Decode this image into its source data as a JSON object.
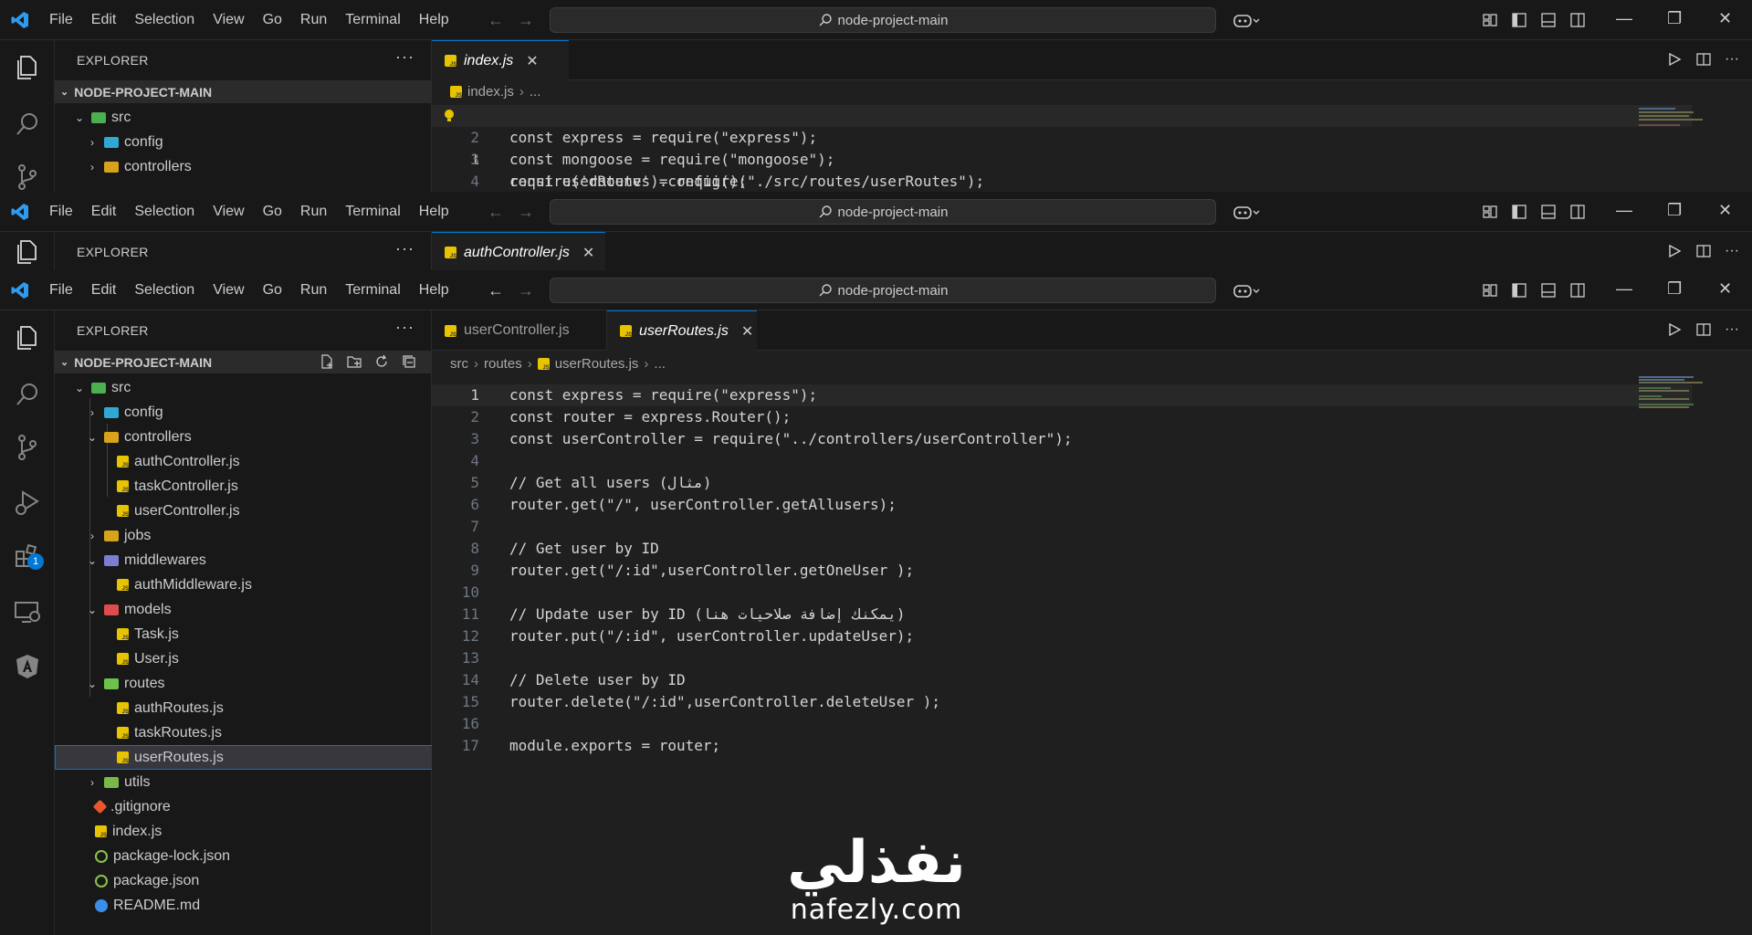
{
  "app": {
    "menu": [
      "File",
      "Edit",
      "Selection",
      "View",
      "Go",
      "Run",
      "Terminal",
      "Help"
    ],
    "search_text": "node-project-main",
    "accent": "#0078d4"
  },
  "window1": {
    "sidebar_title": "EXPLORER",
    "section": "NODE-PROJECT-MAIN",
    "tree": [
      {
        "label": "src",
        "icon": "folder-src-icon"
      },
      {
        "label": "config",
        "icon": "folder-config-icon"
      },
      {
        "label": "controllers",
        "icon": "folder-controllers-icon"
      }
    ],
    "tab": "index.js",
    "breadcrumb": [
      "index.js",
      "..."
    ],
    "lines": [
      {
        "n": "1",
        "t": "require('dotenv').config();"
      },
      {
        "n": "2",
        "t": "const express = require(\"express\");"
      },
      {
        "n": "3",
        "t": "const mongoose = require(\"mongoose\");"
      },
      {
        "n": "4",
        "t": "const userRoutes = require(\"./src/routes/userRoutes\");"
      }
    ]
  },
  "window2": {
    "sidebar_title": "EXPLORER",
    "tab": "authController.js"
  },
  "window3": {
    "sidebar_title": "EXPLORER",
    "section": "NODE-PROJECT-MAIN",
    "tree": [
      {
        "label": "src"
      },
      {
        "label": "config"
      },
      {
        "label": "controllers"
      },
      {
        "label": "authController.js"
      },
      {
        "label": "taskController.js"
      },
      {
        "label": "userController.js"
      },
      {
        "label": "jobs"
      },
      {
        "label": "middlewares"
      },
      {
        "label": "authMiddleware.js"
      },
      {
        "label": "models"
      },
      {
        "label": "Task.js"
      },
      {
        "label": "User.js"
      },
      {
        "label": "routes"
      },
      {
        "label": "authRoutes.js"
      },
      {
        "label": "taskRoutes.js"
      },
      {
        "label": "userRoutes.js"
      },
      {
        "label": "utils"
      },
      {
        "label": ".gitignore"
      },
      {
        "label": "index.js"
      },
      {
        "label": "package-lock.json"
      },
      {
        "label": "package.json"
      },
      {
        "label": "README.md"
      }
    ],
    "tabs": [
      "userController.js",
      "userRoutes.js"
    ],
    "breadcrumb": [
      "src",
      "routes",
      "userRoutes.js",
      "..."
    ],
    "extensions_badge": "1",
    "lines": [
      {
        "n": "1",
        "t": "const express = require(\"express\");"
      },
      {
        "n": "2",
        "t": "const router = express.Router();"
      },
      {
        "n": "3",
        "t": "const userController = require(\"../controllers/userController\");"
      },
      {
        "n": "4",
        "t": ""
      },
      {
        "n": "5",
        "t": "// Get all users (مثال)"
      },
      {
        "n": "6",
        "t": "router.get(\"/\", userController.getAllusers);"
      },
      {
        "n": "7",
        "t": ""
      },
      {
        "n": "8",
        "t": "// Get user by ID"
      },
      {
        "n": "9",
        "t": "router.get(\"/:id\",userController.getOneUser );"
      },
      {
        "n": "10",
        "t": ""
      },
      {
        "n": "11",
        "t": "// Update user by ID (يمكنك إضافة صلاحيات هنا)"
      },
      {
        "n": "12",
        "t": "router.put(\"/:id\", userController.updateUser);"
      },
      {
        "n": "13",
        "t": ""
      },
      {
        "n": "14",
        "t": "// Delete user by ID"
      },
      {
        "n": "15",
        "t": "router.delete(\"/:id\",userController.deleteUser );"
      },
      {
        "n": "16",
        "t": ""
      },
      {
        "n": "17",
        "t": "module.exports = router;"
      }
    ]
  },
  "watermark": {
    "arabic": "نفذلي",
    "latin": "nafezly.com"
  }
}
